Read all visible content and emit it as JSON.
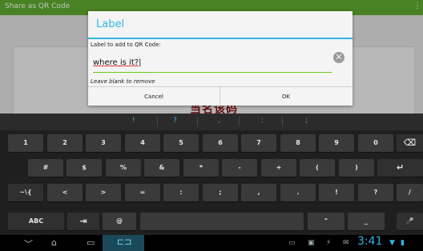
{
  "app": {
    "title": "Share as QR Code",
    "menu_glyph": "⋮",
    "qr_fragment": "当名该码"
  },
  "dialog": {
    "title": "Label",
    "prompt": "Label to add to QR Code:",
    "input_value": "where is it?",
    "hint": "Leave blank to remove",
    "cancel_label": "Cancel",
    "ok_label": "OK",
    "clear_glyph": "✕"
  },
  "keyboard": {
    "suggestions": [
      "!",
      "?",
      ",",
      ":",
      ";"
    ],
    "row1": [
      "1",
      "2",
      "3",
      "4",
      "5",
      "6",
      "7",
      "8",
      "9",
      "0"
    ],
    "row1_end": "⌫",
    "row2": [
      "#",
      "$",
      "%",
      "&",
      "*",
      "-",
      "+",
      "(",
      ")"
    ],
    "row2_end": "↵",
    "row3": [
      "~\\{",
      "<",
      ">",
      "=",
      ":",
      ";",
      ",",
      ".",
      "!",
      "?",
      "/"
    ],
    "row4_abc": "ABC",
    "row4_tab": "⇥",
    "row4_at": "@",
    "row4_quote": "\"",
    "row4_underscore": "_",
    "row4_mic": "🎤"
  },
  "navbar": {
    "back_glyph": "﹀",
    "home_glyph": "⌂",
    "recent_glyph": "▭",
    "clock": "3:41"
  }
}
